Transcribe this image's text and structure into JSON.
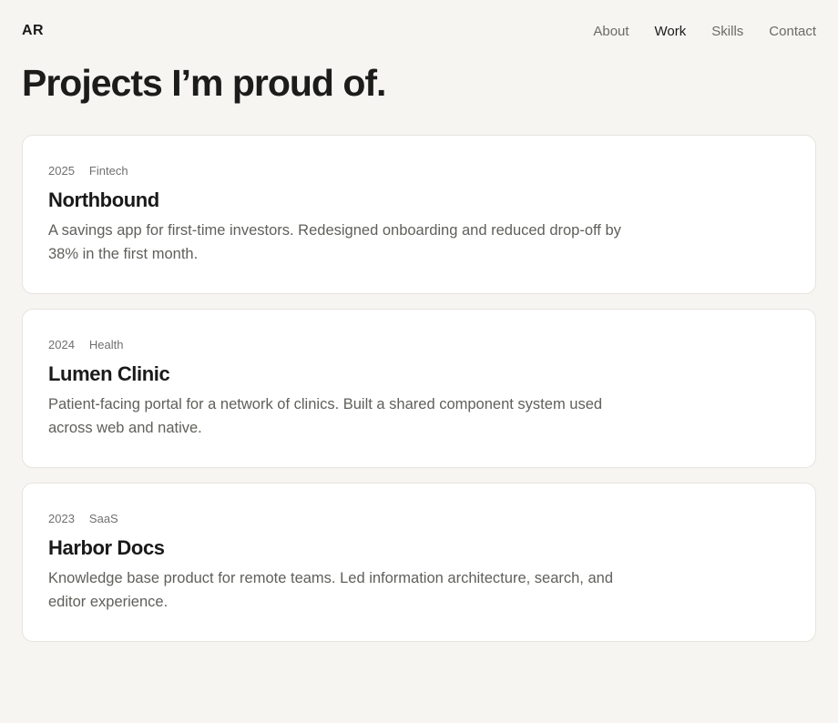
{
  "header": {
    "logo": "AR",
    "nav": [
      {
        "label": "About",
        "active": false
      },
      {
        "label": "Work",
        "active": true
      },
      {
        "label": "Skills",
        "active": false
      },
      {
        "label": "Contact",
        "active": false
      }
    ]
  },
  "page": {
    "title": "Projects I’m proud of."
  },
  "projects": [
    {
      "year": "2025",
      "tag": "Fintech",
      "title": "Northbound",
      "description": "A savings app for first-time investors. Redesigned onboarding and reduced drop-off by 38% in the first month."
    },
    {
      "year": "2024",
      "tag": "Health",
      "title": "Lumen Clinic",
      "description": "Patient-facing portal for a network of clinics. Built a shared component system used across web and native."
    },
    {
      "year": "2023",
      "tag": "SaaS",
      "title": "Harbor Docs",
      "description": "Knowledge base product for remote teams. Led information architecture, search, and editor experience."
    }
  ]
}
